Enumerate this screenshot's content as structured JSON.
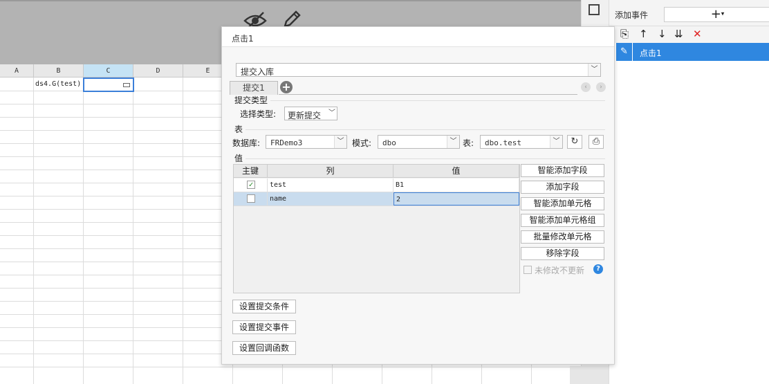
{
  "sheet": {
    "columns": [
      "A",
      "B",
      "C",
      "D",
      "E"
    ],
    "cell_b1": "ds4.G(test)"
  },
  "right_panel": {
    "add_event_label": "添加事件",
    "add_button": "+",
    "event_items": [
      {
        "label": "点击1"
      }
    ]
  },
  "dialog": {
    "title": "点击1",
    "action_type": "提交入库",
    "tab": "提交1",
    "section_submit_type": "提交类型",
    "select_type_label": "选择类型:",
    "select_type_value": "更新提交",
    "section_table": "表",
    "database_label": "数据库:",
    "database_value": "FRDemo3",
    "schema_label": "模式:",
    "schema_value": "dbo",
    "table_label": "表:",
    "table_value": "dbo.test",
    "section_value": "值",
    "columns": {
      "key": "主键",
      "column": "列",
      "value": "值"
    },
    "rows": [
      {
        "key": true,
        "column": "test",
        "value": "B1"
      },
      {
        "key": false,
        "column": "name",
        "value": "2"
      }
    ],
    "side_buttons": [
      "智能添加字段",
      "添加字段",
      "智能添加单元格",
      "智能添加单元格组",
      "批量修改单元格",
      "移除字段"
    ],
    "no_update_label": "未修改不更新",
    "bottom_buttons": [
      "设置提交条件",
      "设置提交事件",
      "设置回调函数"
    ]
  }
}
